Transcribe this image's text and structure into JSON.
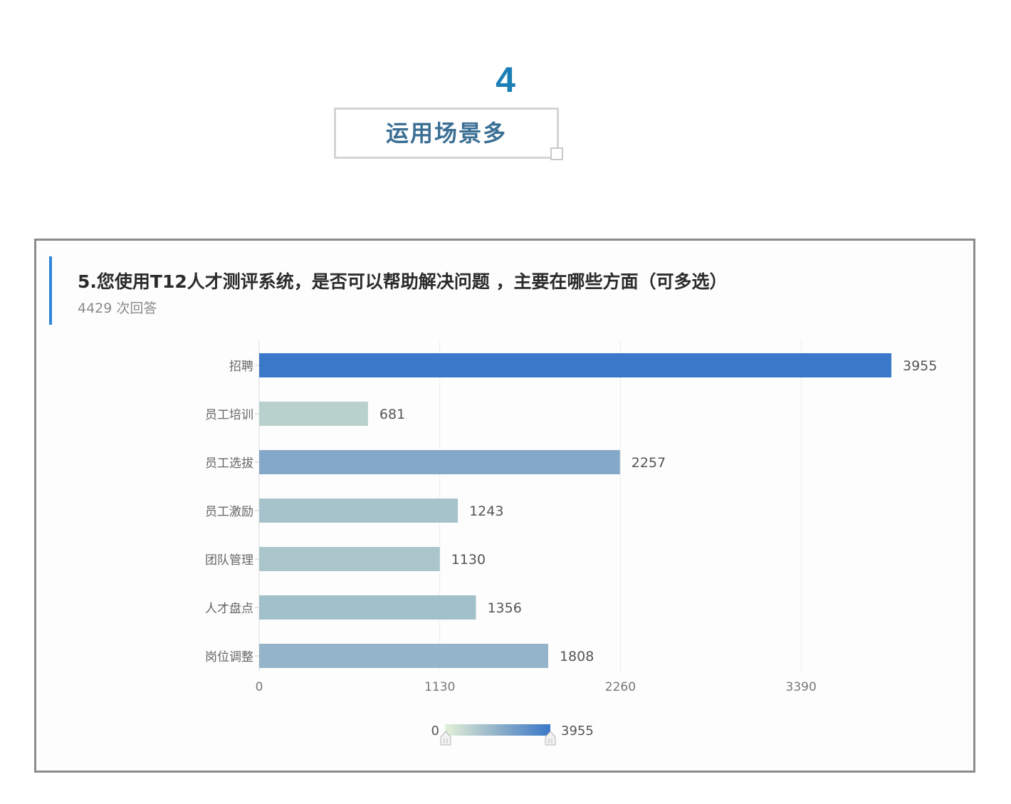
{
  "header": {
    "number": "4",
    "title": "运用场景多"
  },
  "card": {
    "question": "5.您使用T12人才测评系统，是否可以帮助解决问题 ，主要在哪些方面（可多选）",
    "answer_count": "4429 次回答"
  },
  "colors": {
    "accent": "#2f86d8",
    "header_number": "#1b7fb5",
    "header_title": "#3b6f94",
    "scale_low": "#e4f1d8",
    "scale_high": "#3a78c9"
  },
  "chart_data": {
    "type": "bar",
    "orientation": "horizontal",
    "categories": [
      "招聘",
      "员工培训",
      "员工选拔",
      "员工激励",
      "团队管理",
      "人才盘点",
      "岗位调整"
    ],
    "values": [
      3955,
      681,
      2257,
      1243,
      1130,
      1356,
      1808
    ],
    "xlim": [
      0,
      3955
    ],
    "xticks": [
      0,
      1130,
      2260,
      3390
    ],
    "grid": true,
    "visual_map": {
      "min": 0,
      "max": 3955,
      "min_label": "0",
      "max_label": "3955"
    }
  }
}
